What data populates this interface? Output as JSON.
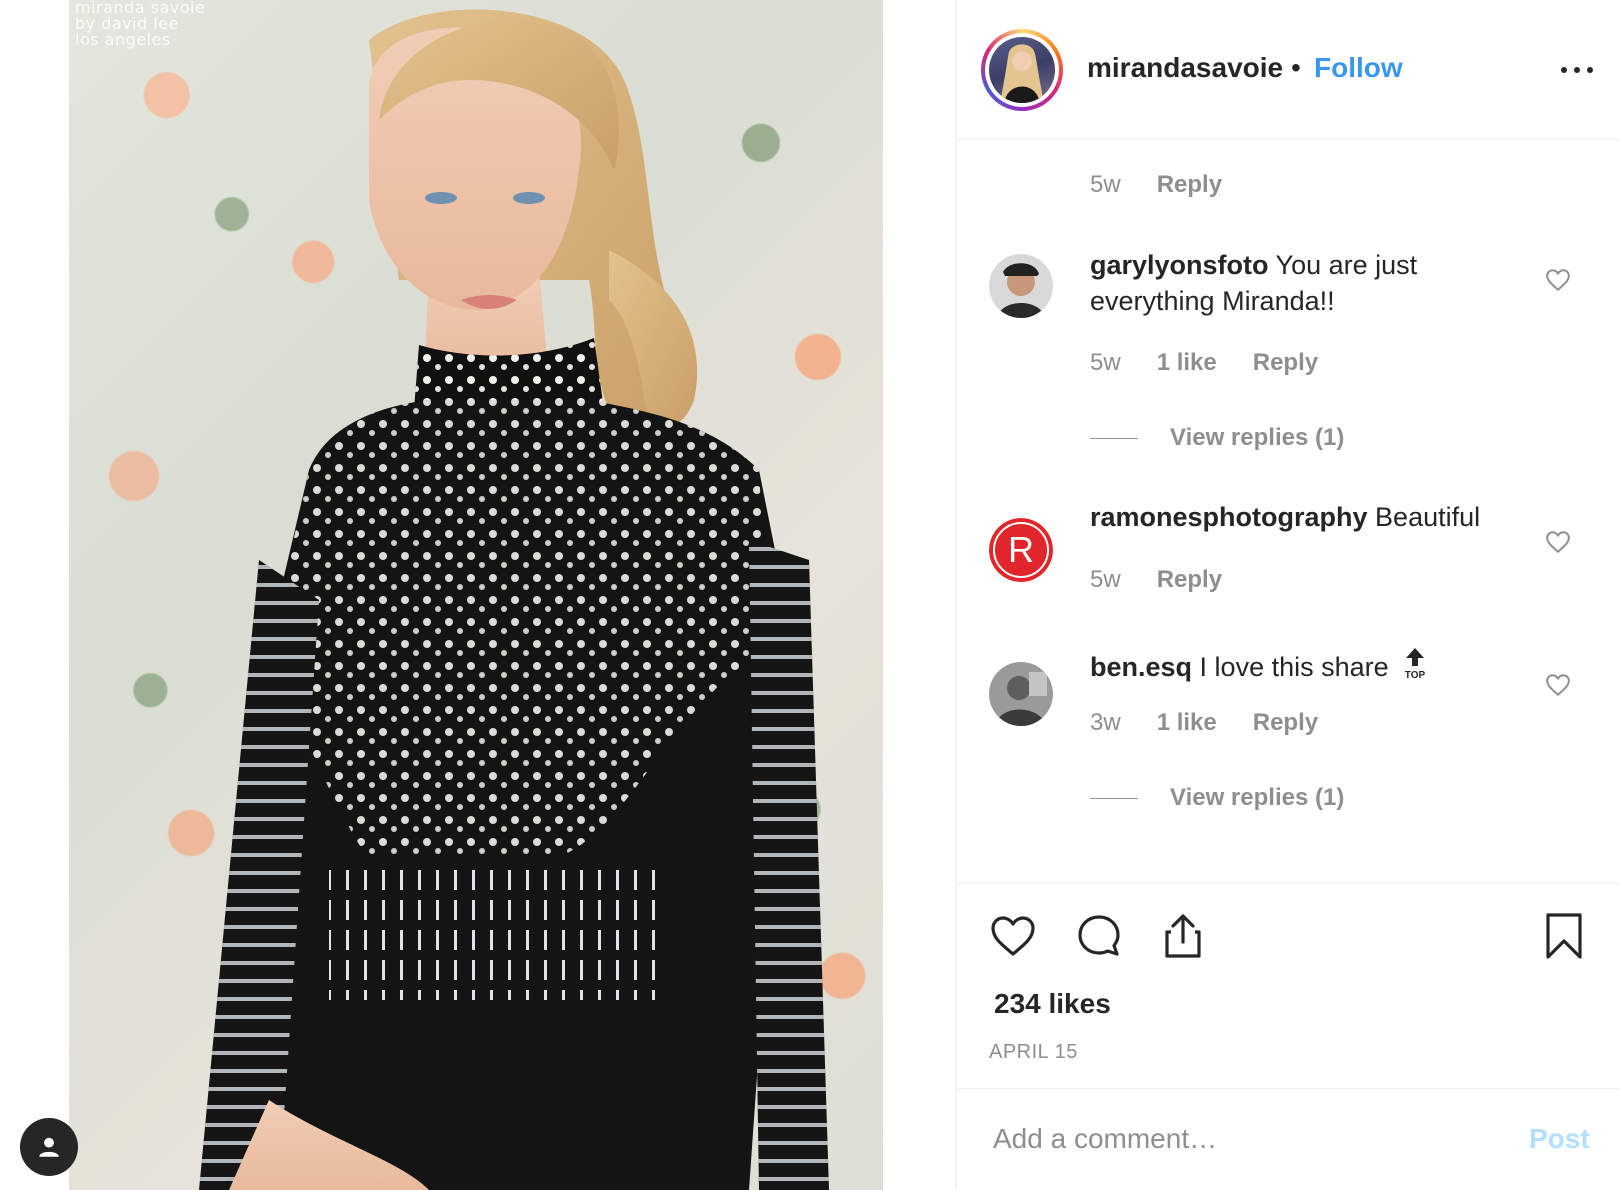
{
  "media": {
    "credit_lines": [
      "miranda savoie",
      "by david lee",
      "los angeles"
    ]
  },
  "header": {
    "username": "mirandasavoie",
    "dot": "•",
    "follow_label": "Follow"
  },
  "comments": {
    "first_meta": {
      "time": "5w",
      "reply": "Reply"
    },
    "items": [
      {
        "username": "garylyonsfoto",
        "text": "You are just everything Miranda!!",
        "time": "5w",
        "likes": "1 like",
        "reply": "Reply",
        "view_replies": "View replies (1)"
      },
      {
        "username": "ramonesphotography",
        "text": "Beautiful",
        "time": "5w",
        "reply": "Reply",
        "avatar_letter": "R"
      },
      {
        "username": "ben.esq",
        "text": "I love this share",
        "badge": "TOP",
        "time": "3w",
        "likes": "1 like",
        "reply": "Reply",
        "view_replies": "View replies (1)"
      }
    ]
  },
  "actions": {
    "likes": "234 likes",
    "date": "APRIL 15"
  },
  "comment_box": {
    "placeholder": "Add a comment…",
    "post_label": "Post"
  },
  "colors": {
    "accent": "#3897f0",
    "muted": "#8e8e8e",
    "text": "#262626",
    "post_disabled": "#b2dffc",
    "ramones_red": "#e0262a"
  }
}
